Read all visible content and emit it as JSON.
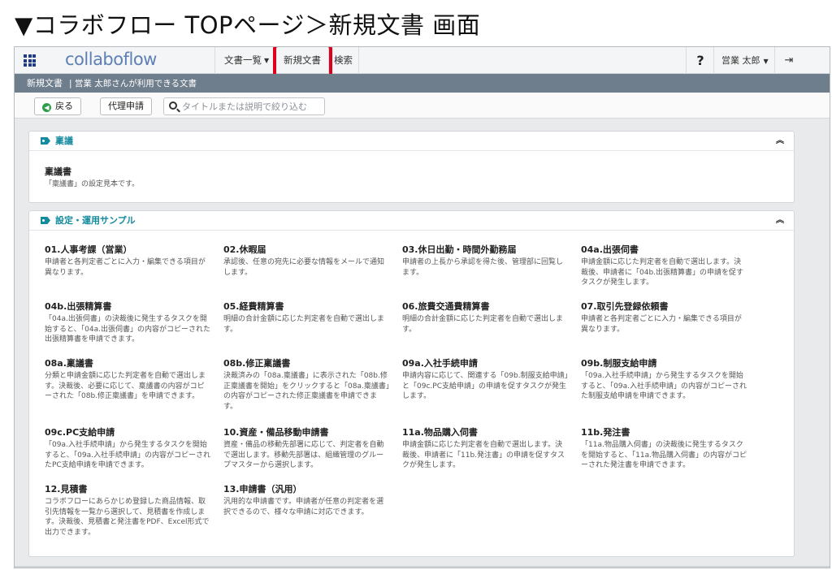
{
  "caption": "▼コラボフロー TOPページ＞新規文書 画面",
  "app": {
    "logo": "collaboflow"
  },
  "nav": {
    "doc_list": "文書一覧",
    "new_doc": "新規文書",
    "search": "検索",
    "help": "?",
    "user": "営業 太郎"
  },
  "crumb": {
    "title": "新規文書",
    "sub": "| 営業 太郎さんが利用できる文書"
  },
  "toolbar": {
    "back": "戻る",
    "proxy": "代理申請",
    "search_placeholder": "タイトルまたは説明で絞り込む"
  },
  "panels": [
    {
      "title": "稟議",
      "docs": [
        {
          "title": "稟議書",
          "desc": "「稟議書」の設定見本です。"
        }
      ]
    },
    {
      "title": "設定・運用サンプル",
      "docs": [
        {
          "title": "01.人事考課（営業）",
          "desc": "申請者と各判定者ごとに入力・編集できる項目が異なります。"
        },
        {
          "title": "02.休暇届",
          "desc": "承認後、任意の宛先に必要な情報をメールで通知します。"
        },
        {
          "title": "03.休日出勤・時間外勤務届",
          "desc": "申請者の上長から承認を得た後、管理部に回覧します。"
        },
        {
          "title": "04a.出張伺書",
          "desc": "申請金額に応じた判定者を自動で選出します。決裁後、申請者に「04b.出張精算書」の申請を促すタスクが発生します。"
        },
        {
          "title": "04b.出張精算書",
          "desc": "「04a.出張伺書」の決裁後に発生するタスクを開始すると、「04a.出張伺書」の内容がコピーされた出張精算書を申請できます。"
        },
        {
          "title": "05.経費精算書",
          "desc": "明細の合計金額に応じた判定者を自動で選出します。"
        },
        {
          "title": "06.旅費交通費精算書",
          "desc": "明細の合計金額に応じた判定者を自動で選出します。"
        },
        {
          "title": "07.取引先登録依頼書",
          "desc": "申請者と各判定者ごとに入力・編集できる項目が異なります。"
        },
        {
          "title": "08a.稟議書",
          "desc": "分類と申請金額に応じた判定者を自動で選出します。決裁後、必要に応じて、稟議書の内容がコピーされた「08b.修正稟議書」を申請できます。"
        },
        {
          "title": "08b.修正稟議書",
          "desc": "決裁済みの「08a.稟議書」に表示された「08b.修正稟議書を開始」をクリックすると「08a.稟議書」の内容がコピーされた修正稟議書を申請できます。"
        },
        {
          "title": "09a.入社手続申請",
          "desc": "申請内容に応じて、関連する「09b.制服支給申請」と「09c.PC支給申請」の申請を促すタスクが発生します。"
        },
        {
          "title": "09b.制服支給申請",
          "desc": "「09a.入社手続申請」から発生するタスクを開始すると、「09a.入社手続申請」の内容がコピーされた制服支給申請を申請できます。"
        },
        {
          "title": "09c.PC支給申請",
          "desc": "「09a.入社手続申請」から発生するタスクを開始すると、「09a.入社手続申請」の内容がコピーされたPC支給申請を申請できます。"
        },
        {
          "title": "10.資産・備品移動申請書",
          "desc": "資産・備品の移動先部署に応じて、判定者を自動で選出します。移動先部署は、組織管理のグループマスターから選択します。"
        },
        {
          "title": "11a.物品購入伺書",
          "desc": "申請金額に応じた判定者を自動で選出します。決裁後、申請者に「11b.発注書」の申請を促すタスクが発生します。"
        },
        {
          "title": "11b.発注書",
          "desc": "「11a.物品購入伺書」の決裁後に発生するタスクを開始すると、「11a.物品購入伺書」の内容がコピーされた発注書を申請できます。"
        },
        {
          "title": "12.見積書",
          "desc": "コラボフローにあらかじめ登録した商品情報、取引先情報を一覧から選択して、見積書を作成します。決裁後、見積書と発注書をPDF、Excel形式で出力できます。"
        },
        {
          "title": "13.申請書（汎用）",
          "desc": "汎用的な申請書です。申請者が任意の判定者を選択できるので、様々な申請に対応できます。"
        }
      ]
    }
  ],
  "colors": {
    "accent": "#138a9e",
    "highlight": "#e0001b",
    "crumb_bg": "#6f7e8c"
  }
}
